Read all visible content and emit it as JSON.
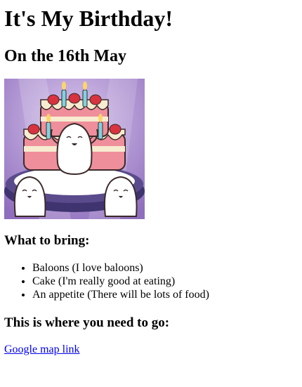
{
  "page": {
    "title": "It's My Birthday!",
    "subtitle": "On the 16th May",
    "bring_heading": "What to bring:",
    "bring_items": [
      "Baloons (I love baloons)",
      "Cake (I'm really good at eating)",
      "An appetite (There will be lots of food)"
    ],
    "where_heading": "This is where you need to go:",
    "map_link_label": "Google map link"
  },
  "image": {
    "depicts": "birthday-cake-with-seals",
    "colors": {
      "background": "#a88ac9",
      "cake_cream": "#f7ecd0",
      "cake_pink": "#ef8f9b",
      "strawberry": "#d8333f",
      "candle": "#7fd3e0",
      "plate": "#5a4b8c"
    }
  }
}
